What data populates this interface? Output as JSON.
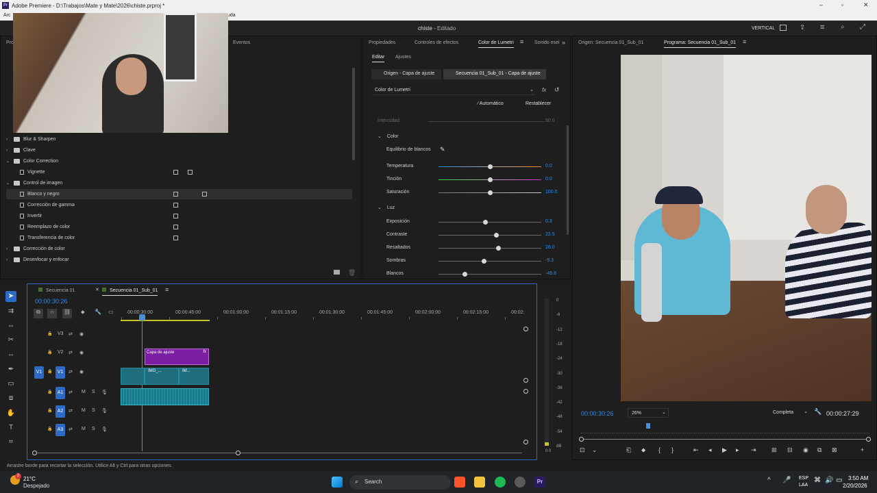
{
  "window": {
    "title": "Adobe Premiere - D:\\Trabajos\\Mate y Mate\\2026\\chiste.prproj *",
    "menu_left": "Arc",
    "menu_right": "uda"
  },
  "header": {
    "project": "chiste",
    "sep": "-",
    "mode": "Editado",
    "layout": "VERTICAL"
  },
  "effects_panel": {
    "tab_left": "Pro",
    "tab_events": "Eventos",
    "items": [
      {
        "label": "Blur & Sharpen",
        "type": "folder",
        "open": false
      },
      {
        "label": "Clave",
        "type": "folder",
        "open": false
      },
      {
        "label": "Color Correction",
        "type": "folder",
        "open": true
      },
      {
        "label": "Vignette",
        "type": "effect"
      },
      {
        "label": "Control de imagen",
        "type": "folder",
        "open": true
      },
      {
        "label": "Blanco y negro",
        "type": "effect",
        "selected": true
      },
      {
        "label": "Corrección de gamma",
        "type": "effect"
      },
      {
        "label": "Invertir",
        "type": "effect"
      },
      {
        "label": "Reemplazo de color",
        "type": "effect"
      },
      {
        "label": "Transferencia de color",
        "type": "effect"
      },
      {
        "label": "Corrección de color",
        "type": "folder",
        "open": false
      },
      {
        "label": "Desenfocar y enfocar",
        "type": "folder",
        "open": false
      }
    ]
  },
  "lumetri": {
    "tabs": [
      "Propiedades",
      "Controles de efectos",
      "Color de Lumetri",
      "Sonido esei"
    ],
    "subtabs": [
      "Editar",
      "Ajustes"
    ],
    "source_btn": "Origen - Capa de ajuste",
    "seq_btn": "Secuencia 01_Sub_01 - Capa de ajuste",
    "effect_select": "Color de Lumetri",
    "auto_label": "Automático",
    "reset_label": "Restablecer",
    "intensity_label": "Intensidad",
    "intensity_value": "50.0",
    "color_section": "Color",
    "wb_label": "Equilibrio de blancos",
    "color_params": [
      {
        "label": "Temperatura",
        "value": "0.0",
        "pos": 0.5
      },
      {
        "label": "Tinción",
        "value": "0.0",
        "pos": 0.5
      },
      {
        "label": "Saturación",
        "value": "100.0",
        "pos": 0.5
      }
    ],
    "luz_section": "Luz",
    "luz_params": [
      {
        "label": "Exposición",
        "value": "0.3",
        "pos": 0.45
      },
      {
        "label": "Contraste",
        "value": "22.5",
        "pos": 0.56
      },
      {
        "label": "Resaltados",
        "value": "26.0",
        "pos": 0.58
      },
      {
        "label": "Sombras",
        "value": "-9.3",
        "pos": 0.44
      },
      {
        "label": "Blancos",
        "value": "-49.8",
        "pos": 0.25
      }
    ]
  },
  "program": {
    "source_tab": "Origen: Secuencia 01_Sub_01",
    "program_tab": "Programa: Secuencia 01_Sub_01",
    "timecode": "00:00:30:26",
    "zoom": "26%",
    "quality": "Completa",
    "duration": "00:00:27:29"
  },
  "timeline": {
    "tabs": [
      "Secuencia 01",
      "Secuencia 01_Sub_01"
    ],
    "timecode": "00:00:30:26",
    "ruler": [
      "00:00:30:00",
      "00:00:45:00",
      "00:01:00:00",
      "00:01:15:00",
      "00:01:30:00",
      "00:01:45:00",
      "00:02:00:00",
      "00:02:15:00",
      "00:02:"
    ],
    "tracks": [
      "V3",
      "V2",
      "V1",
      "A1",
      "A2",
      "A3"
    ],
    "clip_adjust": "Capa de ajuste",
    "clip_img1": "IMG_...",
    "clip_img2": "IM...",
    "meter": [
      "0",
      "-6",
      "-12",
      "-18",
      "-24",
      "-30",
      "-36",
      "-42",
      "-48",
      "-54",
      "dB"
    ],
    "meter_bottom": "0 0"
  },
  "status": "Arrastre borde para recortar la selección. Utilice Alt y Ctrl para otras opciones.",
  "taskbar": {
    "temp": "21°C",
    "weather": "Despejado",
    "search": "Search",
    "lang1": "ESP",
    "lang2": "LAA",
    "time": "3:50 AM",
    "date": "2/20/2026",
    "notif": "2"
  },
  "colors": {
    "accent": "#2d8ceb",
    "adjust_clip": "#7b1fa2",
    "video_clip": "#1f6e7e",
    "audio_clip": "#1a7a8a",
    "playhead": "#4a8fdc"
  }
}
